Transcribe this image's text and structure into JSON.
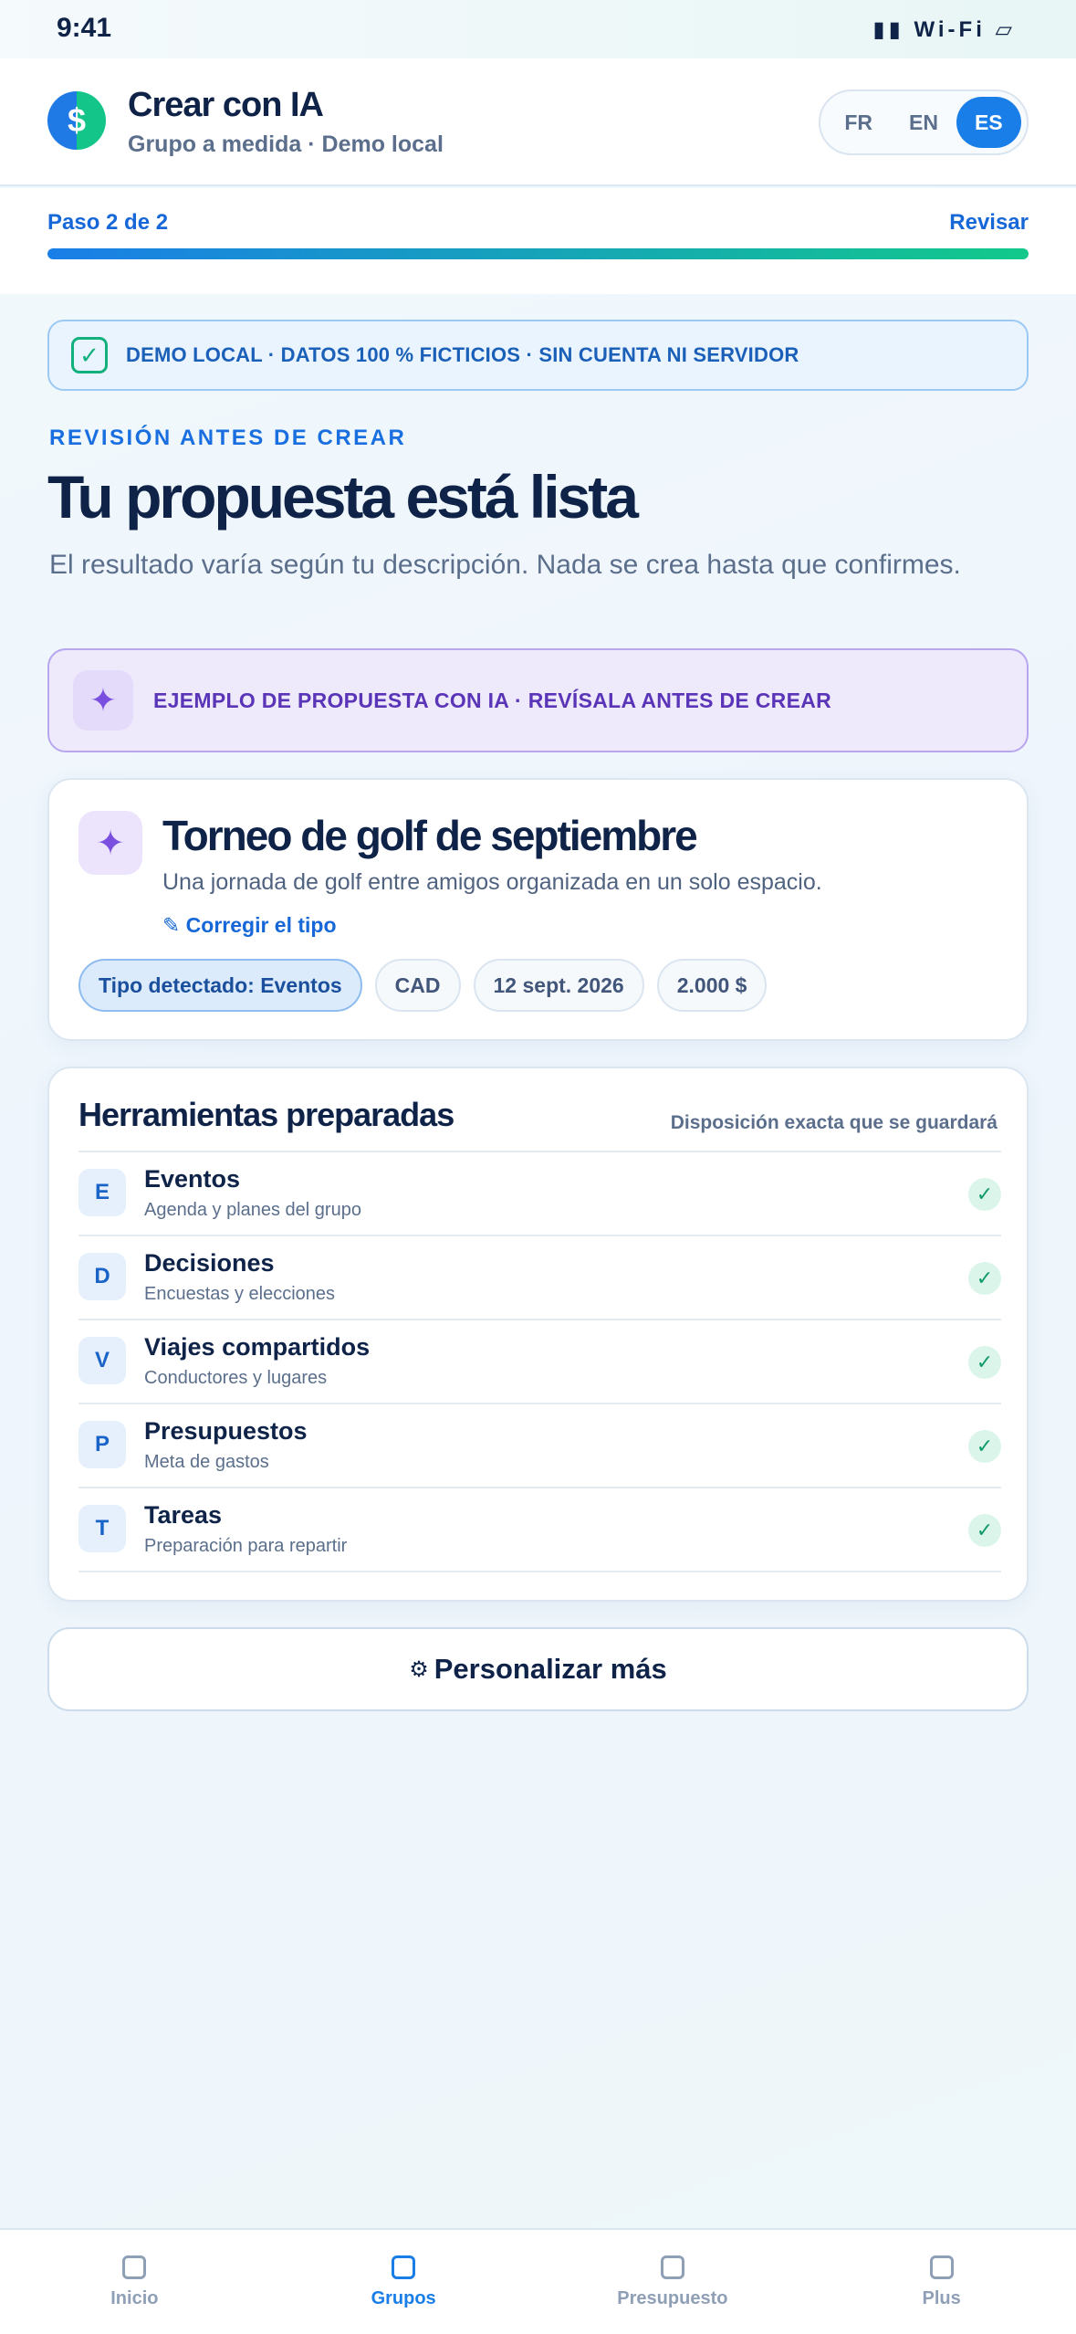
{
  "status": {
    "time": "9:41",
    "system": "▮▮ Wi-Fi ▱"
  },
  "header": {
    "logo_symbol": "$",
    "title": "Crear con IA",
    "subtitle": "Grupo a medida · Demo local",
    "languages": [
      "FR",
      "EN",
      "ES"
    ],
    "selected_language": "ES"
  },
  "step": {
    "label": "Paso 2 de 2",
    "action": "Revisar",
    "progress": 1.0
  },
  "demo_banner": {
    "check": "✓",
    "text": "DEMO LOCAL · DATOS 100 % FICTICIOS · SIN CUENTA NI SERVIDOR"
  },
  "intro": {
    "eyebrow": "REVISIÓN ANTES DE CREAR",
    "title": "Tu propuesta está lista",
    "subtitle": "El resultado varía según tu descripción. Nada se crea hasta que confirmes."
  },
  "ai_banner": {
    "icon": "sparkle-icon",
    "spark": "✦",
    "text": "EJEMPLO DE PROPUESTA CON IA · REVÍSALA ANTES DE CREAR"
  },
  "proposal": {
    "spark": "✦",
    "title": "Torneo de golf de septiembre",
    "description": "Una jornada de golf entre amigos organizada en un solo espacio.",
    "fix_link": "✎ Corregir el tipo",
    "chips": [
      "Tipo detectado: Eventos",
      "CAD",
      "12 sept. 2026",
      "2.000 $"
    ]
  },
  "tools": {
    "title": "Herramientas preparadas",
    "note": "Disposición exacta que se guardará",
    "check": "✓",
    "items": [
      {
        "badge": "E",
        "name": "Eventos",
        "desc": "Agenda y planes del grupo"
      },
      {
        "badge": "D",
        "name": "Decisiones",
        "desc": "Encuestas y elecciones"
      },
      {
        "badge": "V",
        "name": "Viajes compartidos",
        "desc": "Conductores y lugares"
      },
      {
        "badge": "P",
        "name": "Presupuestos",
        "desc": "Meta de gastos"
      },
      {
        "badge": "T",
        "name": "Tareas",
        "desc": "Preparación para repartir"
      }
    ]
  },
  "customize": {
    "icon": "gear-icon",
    "gear": "⚙",
    "label": "Personalizar más"
  },
  "tabbar": {
    "items": [
      {
        "label": "Inicio"
      },
      {
        "label": "Grupos"
      },
      {
        "label": "Presupuesto"
      },
      {
        "label": "Plus"
      }
    ],
    "active": "Grupos"
  },
  "colors": {
    "accent": "#1a7ee8",
    "success": "#12c98a",
    "ai": "#7a4fe0",
    "text": "#0f2348",
    "muted": "#5b6f8c"
  }
}
